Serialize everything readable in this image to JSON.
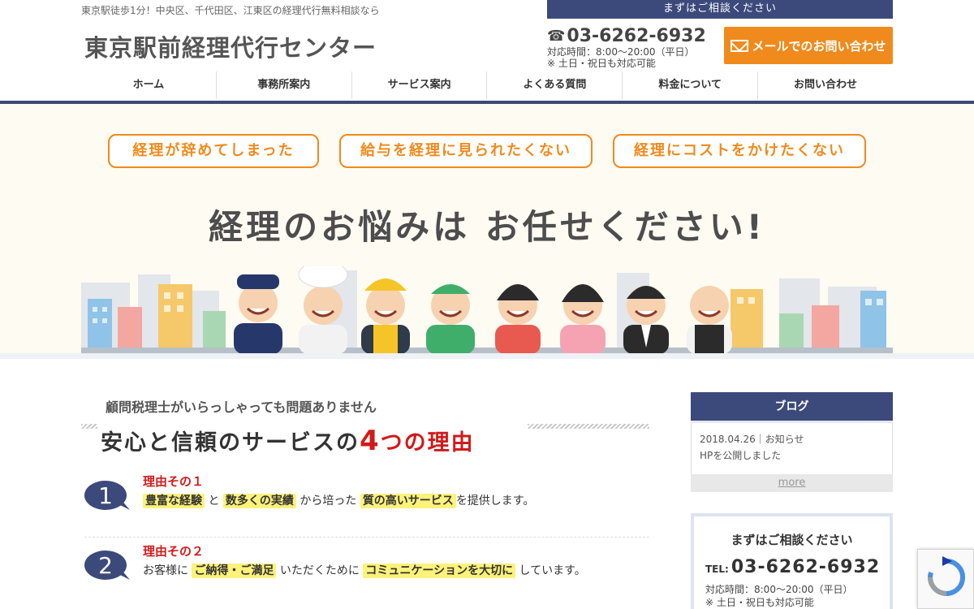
{
  "header": {
    "tagline": "東京駅徒歩1分！中央区、千代田区、江東区の経理代行無料相談なら",
    "logo": "東京駅前経理代行センター",
    "consult_bar": "まずはご相談ください",
    "phone": "03-6262-6932",
    "hours": "対応時間：8:00〜20:00（平日）",
    "hours_note": "※ 土日・祝日も対応可能",
    "mail_button": "メールでのお問い合わせ",
    "accent": "#3b4a7a",
    "orange": "#f08a1c"
  },
  "nav": [
    {
      "label": "ホーム"
    },
    {
      "label": "事務所案内"
    },
    {
      "label": "サービス案内"
    },
    {
      "label": "よくある質問"
    },
    {
      "label": "料金について"
    },
    {
      "label": "お問い合わせ"
    }
  ],
  "hero": {
    "pills": [
      "経理が辞めてしまった",
      "給与を経理に見られたくない",
      "経理にコストをかけたくない"
    ],
    "title": "経理のお悩みは お任せください!"
  },
  "main": {
    "lead": "顧問税理士がいらっしゃっても問題ありません",
    "title_pre": "安心と信頼のサービスの",
    "title_num": "4",
    "title_post": "つの理由",
    "reasons": [
      {
        "label": "理由その１",
        "number": "1",
        "hl1": "豊富な経験",
        "t1": "と",
        "hl2": "数多くの実績",
        "t2": "から培った",
        "hl3": "質の高いサービス",
        "t3": "を提供します。"
      },
      {
        "label": "理由その２",
        "number": "2",
        "t0": "お客様に",
        "hl1": "ご納得・ご満足",
        "t1": "いただくために",
        "hl2": "コミュニケーションを大切に",
        "t2": "しています。"
      }
    ]
  },
  "sidebar": {
    "blog_title": "ブログ",
    "post_meta": "2018.04.26｜お知らせ",
    "post_title": "HPを公開しました",
    "more": "more",
    "consult_title": "まずはご相談ください",
    "tel_prefix": "TEL:",
    "tel": "03-6262-6932",
    "hours": "対応時間：8:00〜20:00（平日）",
    "hours_note": "※ 土日・祝日も対応可能"
  }
}
